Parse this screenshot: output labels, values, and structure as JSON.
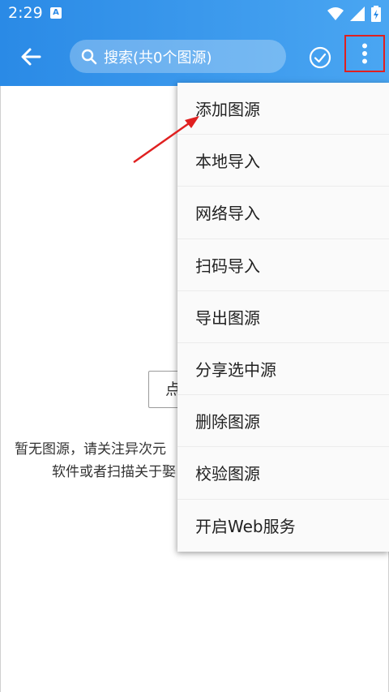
{
  "status_bar": {
    "time": "2:29",
    "notification_icon": "A"
  },
  "app_bar": {
    "search_placeholder": "搜索(共0个图源)"
  },
  "empty_state": {
    "button_label": "点",
    "message_line1": "暂无图源，请关注异次元",
    "message_line2": "软件或者扫描关于娶"
  },
  "menu": {
    "items": [
      "添加图源",
      "本地导入",
      "网络导入",
      "扫码导入",
      "导出图源",
      "分享选中源",
      "删除图源",
      "校验图源",
      "开启Web服务"
    ]
  },
  "colors": {
    "accent": "#2a8ae6",
    "highlight_box": "#e02020",
    "arrow": "#e02020"
  }
}
